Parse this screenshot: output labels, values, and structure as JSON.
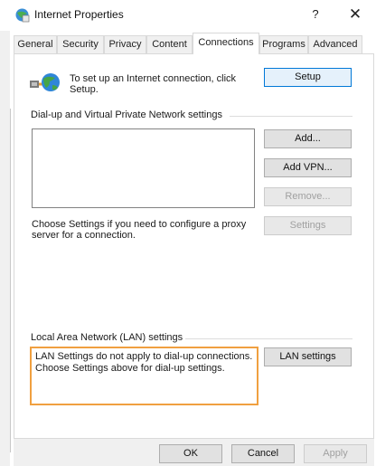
{
  "window": {
    "title": "Internet Properties",
    "help_glyph": "?",
    "close_glyph": "✕"
  },
  "tabs": [
    {
      "label": "General"
    },
    {
      "label": "Security"
    },
    {
      "label": "Privacy"
    },
    {
      "label": "Content"
    },
    {
      "label": "Connections"
    },
    {
      "label": "Programs"
    },
    {
      "label": "Advanced"
    }
  ],
  "active_tab": "Connections",
  "setup": {
    "text": "To set up an Internet connection, click Setup.",
    "button": "Setup"
  },
  "dialup": {
    "group_label": "Dial-up and Virtual Private Network settings",
    "add_button": "Add...",
    "add_vpn_button": "Add VPN...",
    "remove_button": "Remove...",
    "settings_button": "Settings",
    "proxy_text": "Choose Settings if you need to configure a proxy server for a connection."
  },
  "lan": {
    "group_label": "Local Area Network (LAN) settings",
    "info_line1": "LAN Settings do not apply to dial-up connections.",
    "info_line2": "Choose Settings above for dial-up settings.",
    "button": "LAN settings"
  },
  "footer": {
    "ok": "OK",
    "cancel": "Cancel",
    "apply": "Apply"
  },
  "colors": {
    "accent": "#0078d7",
    "highlight": "#f0a040"
  }
}
